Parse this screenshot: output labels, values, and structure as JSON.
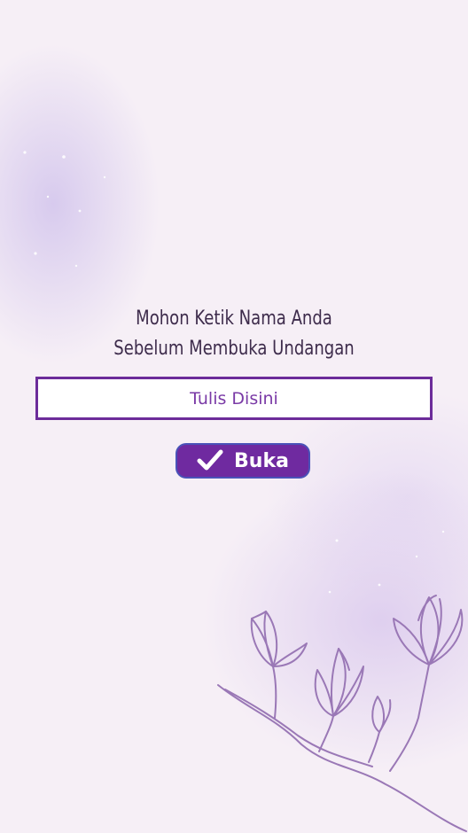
{
  "prompt": {
    "line1": "Mohon Ketik Nama Anda",
    "line2": "Sebelum Membuka Undangan"
  },
  "name_input": {
    "placeholder": "Tulis Disini",
    "value": ""
  },
  "open_button": {
    "label": "Buka",
    "icon": "check-icon"
  },
  "colors": {
    "background": "#f6eff6",
    "accent": "#6f2aa0",
    "input_border": "#6c2c9a",
    "title_text": "#3e2c4c",
    "flower_line": "#9a78b6"
  }
}
